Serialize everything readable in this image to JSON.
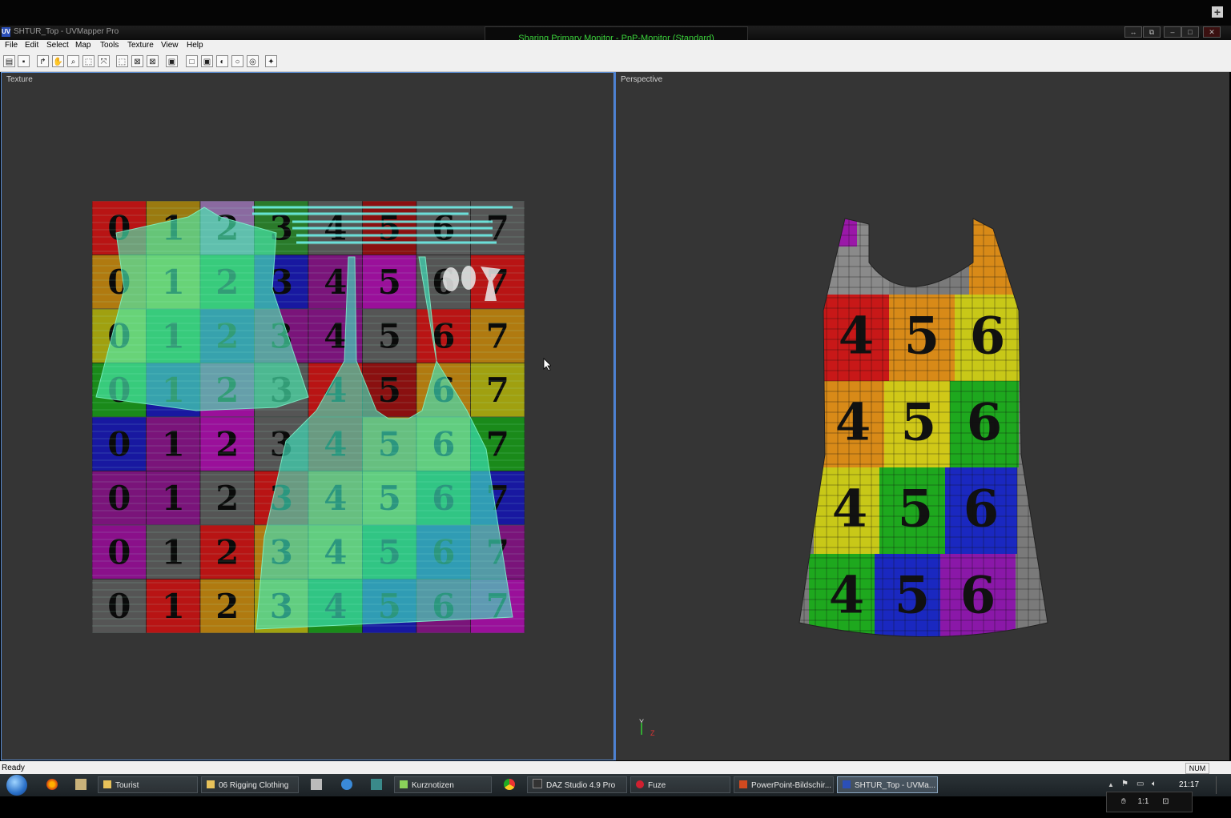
{
  "window": {
    "title": "SHTUR_Top - UVMapper Pro",
    "app_icon_text": "UV",
    "sharing_banner": "Sharing Primary Monitor - PnP-Monitor (Standard)",
    "controls": [
      "↔",
      "⧉",
      "–",
      "□",
      "✕"
    ]
  },
  "menu": [
    "File",
    "Edit",
    "Select",
    "Map",
    "Tools",
    "Texture",
    "View",
    "Help"
  ],
  "toolbar": [
    "▤",
    "▪",
    "↱",
    "✋",
    "⌕",
    "⬚",
    "⤧",
    "⬚",
    "⊠",
    "⊠",
    "▣",
    "□",
    "▣",
    "◐",
    "○",
    "◎",
    "✦"
  ],
  "panes": {
    "texture_label": "Texture",
    "perspective_label": "Perspective",
    "axis_y": "Y",
    "axis_z": "Z"
  },
  "texture_grid": {
    "rows": [
      [
        "0",
        "1",
        "2",
        "3",
        "4",
        "5",
        "6",
        "7"
      ],
      [
        "0",
        "1",
        "2",
        "3",
        "4",
        "5",
        "6",
        "7"
      ],
      [
        "0",
        "1",
        "2",
        "3",
        "4",
        "5",
        "6",
        "7"
      ],
      [
        "0",
        "1",
        "2",
        "3",
        "4",
        "5",
        "6",
        "7"
      ],
      [
        "0",
        "1",
        "2",
        "3",
        "4",
        "5",
        "6",
        "7"
      ],
      [
        "0",
        "1",
        "2",
        "3",
        "4",
        "5",
        "6",
        "7"
      ],
      [
        "0",
        "1",
        "2",
        "3",
        "4",
        "5",
        "6",
        "7"
      ],
      [
        "0",
        "1",
        "2",
        "3",
        "4",
        "5",
        "6",
        "7"
      ]
    ],
    "colors": [
      [
        "#b81414",
        "#9a7a10",
        "#8a6aa0",
        "#2a7a2a",
        "#555555",
        "#8a1010",
        "#5a5a5a",
        "#555555"
      ],
      [
        "#b07a10",
        "#a0a010",
        "#1a8a1a",
        "#1818a0",
        "#7a147a",
        "#9a109a",
        "#555555",
        "#b81414"
      ],
      [
        "#a0a010",
        "#1a8a1a",
        "#1818a0",
        "#7a147a",
        "#7a147a",
        "#555555",
        "#b81414",
        "#b07a10"
      ],
      [
        "#1a8a1a",
        "#1818a0",
        "#9a109a",
        "#555555",
        "#b81414",
        "#8a1010",
        "#b07a10",
        "#a0a010"
      ],
      [
        "#1818a0",
        "#7a147a",
        "#9a109a",
        "#555555",
        "#b81414",
        "#b07a10",
        "#a0a010",
        "#1a8a1a"
      ],
      [
        "#7a147a",
        "#7a147a",
        "#555555",
        "#b81414",
        "#b07a10",
        "#a0a010",
        "#1a8a1a",
        "#1818a0"
      ],
      [
        "#8a108a",
        "#555555",
        "#b81414",
        "#b07a10",
        "#a0a010",
        "#1a8a1a",
        "#1818a0",
        "#7a147a"
      ],
      [
        "#555555",
        "#b81414",
        "#b07a10",
        "#a0a010",
        "#1a8a1a",
        "#1818a0",
        "#7a147a",
        "#9a109a"
      ]
    ]
  },
  "garment_grid": {
    "rows": [
      [
        "4",
        "5",
        "6"
      ],
      [
        "4",
        "5",
        "6"
      ],
      [
        "4",
        "5",
        "6"
      ],
      [
        "4",
        "5",
        "6"
      ]
    ],
    "colors": [
      [
        "#c81818",
        "#d88a18",
        "#c8c818"
      ],
      [
        "#d88a18",
        "#d0c818",
        "#1ea81e"
      ],
      [
        "#c8c818",
        "#1ea81e",
        "#1a28c0"
      ],
      [
        "#1ea81e",
        "#1a28c0",
        "#8a18a8"
      ]
    ]
  },
  "status": {
    "text": "Ready",
    "num": "NUM"
  },
  "taskbar": {
    "items": [
      {
        "label": "Tourist",
        "active": false
      },
      {
        "label": "06 Rigging Clothing",
        "active": false
      },
      {
        "label": "Kurznotizen",
        "active": false
      },
      {
        "label": "DAZ Studio 4.9 Pro",
        "active": false
      },
      {
        "label": "Fuze",
        "active": false
      },
      {
        "label": "PowerPoint-Bildschir...",
        "active": false
      },
      {
        "label": "SHTUR_Top - UVMa...",
        "active": true
      }
    ],
    "clock": "21:17",
    "zoom": "1:1"
  }
}
